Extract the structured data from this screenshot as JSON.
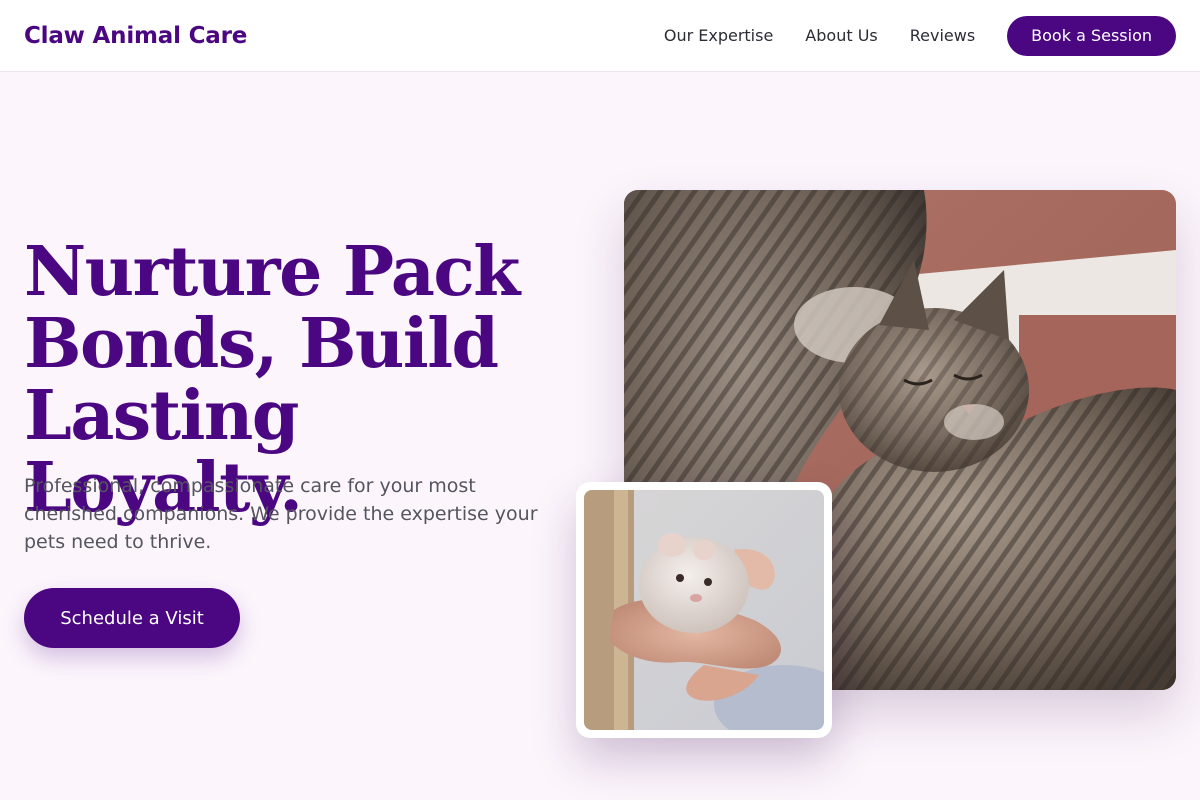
{
  "header": {
    "brand": "Claw Animal Care",
    "nav": {
      "expertise": "Our Expertise",
      "about": "About Us",
      "reviews": "Reviews"
    },
    "book_label": "Book a Session"
  },
  "hero": {
    "title_line1": "Nurture Pack",
    "title_line2": "Bonds, Build",
    "title_line3": "Lasting Loyalty.",
    "subtitle": "Professional, compassionate care for your most cherished companions. We provide the expertise your pets need to thrive.",
    "cta_label": "Schedule a Visit"
  },
  "images": {
    "main": "two-tabby-cats-cuddling-photo",
    "inset": "hamster-in-hand-photo"
  },
  "colors": {
    "brand": "#4b0682",
    "page_bg": "#fcf5fc",
    "text_muted": "#55555f"
  }
}
